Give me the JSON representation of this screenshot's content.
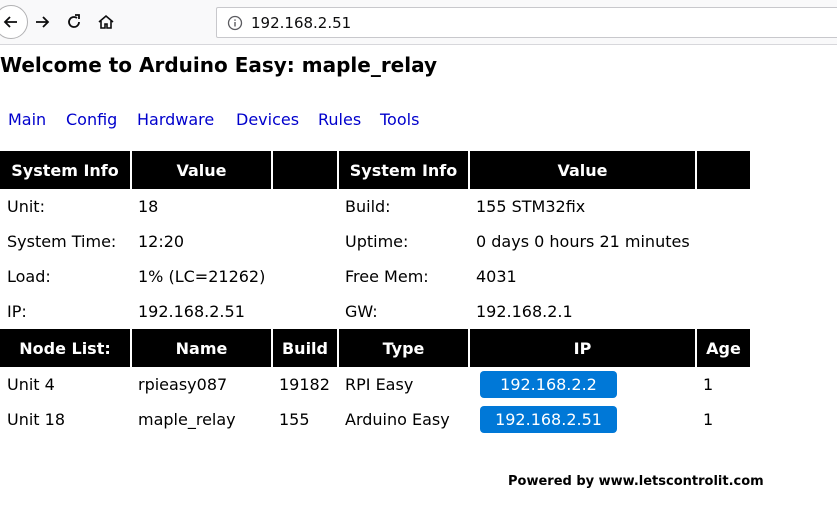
{
  "browser": {
    "url": "192.168.2.51",
    "icons": [
      "back-arrow-icon",
      "forward-arrow-icon",
      "reload-icon",
      "home-icon",
      "info-icon"
    ]
  },
  "page": {
    "title": "Welcome to Arduino Easy: maple_relay"
  },
  "menu": [
    "Main",
    "Config",
    "Hardware",
    "Devices",
    "Rules",
    "Tools"
  ],
  "sysinfo": {
    "headers": [
      "System Info",
      "Value",
      "",
      "System Info",
      "Value",
      ""
    ],
    "rows": [
      [
        "Unit:",
        "18",
        "",
        "Build:",
        "155 STM32fix",
        ""
      ],
      [
        "System Time:",
        "12:20",
        "",
        "Uptime:",
        "0 days 0 hours 21 minutes",
        ""
      ],
      [
        "Load:",
        "1% (LC=21262)",
        "",
        "Free Mem:",
        "4031",
        ""
      ],
      [
        "IP:",
        "192.168.2.51",
        "",
        "GW:",
        "192.168.2.1",
        ""
      ]
    ]
  },
  "nodes": {
    "headers": [
      "Node List:",
      "Name",
      "Build",
      "Type",
      "IP",
      "Age"
    ],
    "rows": [
      {
        "unit": "Unit 4",
        "name": "rpieasy087",
        "build": "19182",
        "type": "RPI Easy",
        "ip": "192.168.2.2",
        "age": "1"
      },
      {
        "unit": "Unit 18",
        "name": "maple_relay",
        "build": "155",
        "type": "Arduino Easy",
        "ip": "192.168.2.51",
        "age": "1"
      }
    ]
  },
  "footer": "Powered by www.letscontrolit.com",
  "colors": {
    "link": "#0000cc",
    "header_bg": "#000000",
    "ip_button": "#0078d7"
  }
}
